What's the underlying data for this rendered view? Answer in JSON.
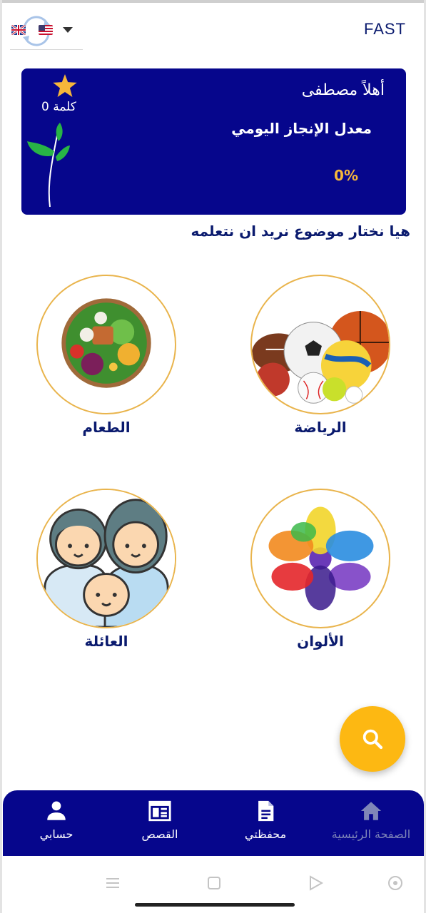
{
  "header": {
    "brand": "FAST",
    "language": {
      "flags": [
        "uk-flag",
        "us-flag"
      ],
      "swap_icon": "sync-icon",
      "dropdown_icon": "caret-down-icon"
    }
  },
  "welcome_card": {
    "greeting": "أهلاً مصطفى",
    "daily_rate_label": "معدل الإنجاز اليومي",
    "daily_rate_value": "0%",
    "words_count": "كلمة 0",
    "colors": {
      "background": "#06068c",
      "accent": "#f6b63a"
    }
  },
  "prompt": "هيا نختار موضوع نريد ان نتعلمه",
  "topics": [
    {
      "label": "الرياضة",
      "icon": "sports-balls-image"
    },
    {
      "label": "الطعام",
      "icon": "food-bowl-image"
    },
    {
      "label": "الألوان",
      "icon": "color-powder-image"
    },
    {
      "label": "العائلة",
      "icon": "family-image"
    }
  ],
  "fab": {
    "icon": "search-icon",
    "color": "#fdb812"
  },
  "bottom_nav": [
    {
      "label": "حسابي",
      "icon": "person-icon"
    },
    {
      "label": "القصص",
      "icon": "newspaper-icon"
    },
    {
      "label": "محفظتي",
      "icon": "document-icon"
    },
    {
      "label": "الصفحة الرئيسية",
      "icon": "home-icon"
    }
  ],
  "system_nav": [
    "menu-icon",
    "square-icon",
    "back-triangle-icon",
    "target-icon"
  ]
}
